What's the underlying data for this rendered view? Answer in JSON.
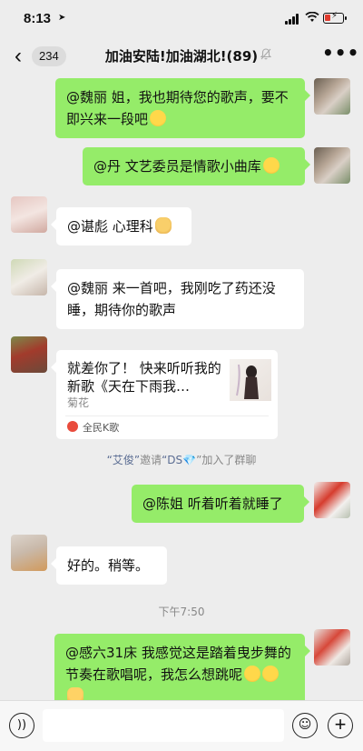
{
  "status_bar": {
    "time": "8:13",
    "location_icon": "location-arrow-icon",
    "signal_icon": "cellular-signal-icon",
    "wifi_icon": "wifi-icon",
    "battery_icon": "battery-charging-icon",
    "battery_color": "#e03b2e"
  },
  "nav": {
    "back_icon": "chevron-left-icon",
    "back_glyph": "‹",
    "unread_count": "234",
    "title": "加油安陆!加油湖北!(89)",
    "mute_icon": "bell-muted-icon",
    "more_icon": "more-icon",
    "more_glyph": "•••"
  },
  "colors": {
    "chat_background": "#ededed",
    "my_bubble": "#95ec69",
    "other_bubble": "#ffffff",
    "system_highlight": "#5b6d93"
  },
  "messages": [
    {
      "from": "me",
      "text": "@魏丽 姐，我也期待您的歌声，要不即兴来一段吧",
      "emoji": [
        "grinning-emoji"
      ]
    },
    {
      "from": "me",
      "text": "@丹 文艺委员是情歌小曲库",
      "emoji": [
        "hugging-emoji"
      ]
    },
    {
      "from": "other",
      "text": "@谌彪 心理科",
      "emoji": [
        "handshake-emoji"
      ]
    },
    {
      "from": "other",
      "text": "@魏丽 来一首吧，我刚吃了药还没睡，期待你的歌声"
    },
    {
      "from": "other",
      "type": "music-card",
      "title": "就差你了！ 快来听听我的新歌《天在下雨我…",
      "singer": "菊花",
      "app_name": "全民K歌"
    },
    {
      "type": "system",
      "inviter": "“艾俊”",
      "action": "邀请",
      "invitee": "“DS",
      "diamond": "💎",
      "rest": "”加入了群聊"
    },
    {
      "from": "me",
      "text": "@陈姐 听着听着就睡了"
    },
    {
      "from": "other",
      "text": "好的。稍等。"
    },
    {
      "type": "timestamp",
      "text": "下午7:50"
    },
    {
      "from": "me",
      "text": "@感六31床 我感觉这是踏着曳步舞的节奏在歌唱呢，我怎么想跳呢",
      "emoji": [
        "hugging-emoji",
        "hugging-emoji",
        "thumbs-up-emoji"
      ]
    }
  ],
  "input_bar": {
    "voice_icon": "voice-input-icon",
    "voice_glyph": "))",
    "emoji_icon": "emoji-smile-icon",
    "emoji_glyph": "☺",
    "plus_icon": "plus-icon",
    "plus_glyph": "+"
  }
}
